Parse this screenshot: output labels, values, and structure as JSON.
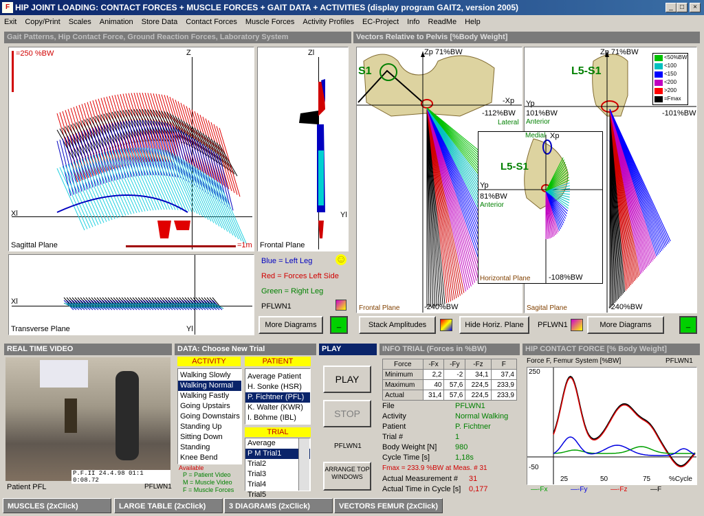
{
  "window": {
    "title": "HIP JOINT LOADING:  CONTACT FORCES + MUSCLE FORCES + GAIT DATA + ACTIVITIES (display program GAIT2, version 2005)"
  },
  "menu": [
    "Exit",
    "Copy/Print",
    "Scales",
    "Animation",
    "Store Data",
    "Contact Forces",
    "Muscle Forces",
    "Activity Profiles",
    "EC-Project",
    "Info",
    "ReadMe",
    "Help"
  ],
  "gait": {
    "title": "Gait Patterns, Hip Contact Force, Ground Reaction Forces, Laboratory System",
    "scale_label": "=250 %BW",
    "z": "Z",
    "zl": "Zl",
    "xl": "Xl",
    "yl": "Yl",
    "sagittal": "Sagittal Plane",
    "meter": "=1m",
    "frontal": "Frontal Plane",
    "transverse": "Transverse Plane",
    "legend_blue": "Blue = Left Leg",
    "legend_red": "Red = Forces Left Side",
    "legend_green": "Green = Right Leg",
    "trial": "PFLWN1",
    "more": "More Diagrams",
    "smiley": "☺"
  },
  "vectors": {
    "title": "Vectors Relative to Pelvis  [%Body Weight]",
    "zp_left": "Zp 71%BW",
    "s1": "S1",
    "neg_xp": "-Xp",
    "neg112": "-112%BW",
    "lateral": "Lateral",
    "frontal": "Frontal Plane",
    "neg240a": "-240%BW",
    "zp_right": "Zp 71%BW",
    "l5s1": "L5-S1",
    "yp": "Yp",
    "bw101": "101%BW",
    "anterior": "Anterior",
    "neg101": "-101%BW",
    "sagital": "Sagital Plane",
    "neg240b": "-240%BW",
    "medial": "Medial",
    "xp": "Xp",
    "l5s1b": "L5-S1",
    "yp2": "Yp",
    "bw81": "81%BW",
    "anterior2": "Anterior",
    "horizontal": "Horizontal Plane",
    "neg108": "-108%BW",
    "legend": [
      "<50%BW",
      "<100",
      "<150",
      "<200",
      ">200",
      "=Fmax"
    ],
    "legend_colors": [
      "#00c000",
      "#00c0c0",
      "#0000ff",
      "#c000c0",
      "#ff0000",
      "#000000"
    ],
    "stack": "Stack Amplitudes",
    "hide": "Hide Horiz. Plane",
    "trial": "PFLWN1",
    "more": "More Diagrams"
  },
  "video": {
    "title": "REAL TIME VIDEO",
    "patient": "Patient PFL",
    "code": "PFLWN1",
    "stamp": "P.F.II  24.4.98   01:1 0:08.72"
  },
  "data": {
    "title": "DATA: Choose New Trial",
    "activity_label": "ACTIVITY",
    "patient_label": "PATIENT",
    "activities": [
      "Walking Slowly",
      "Walking Normal",
      "Walking Fastly",
      "Going Upstairs",
      "Going Downstairs",
      "Standing Up",
      "Sitting Down",
      "Standing",
      "Knee Bend"
    ],
    "patients": [
      "Average Patient",
      "H. Sonke   (HSR)",
      "P. Fichtner (PFL)",
      "K. Walter   (KWR)",
      "I. Böhme    (IBL)"
    ],
    "trial_label": "TRIAL",
    "trials": [
      "Average",
      "P M  Trial1",
      "Trial2",
      "Trial3",
      "Trial4",
      "Trial5"
    ],
    "available": "Available",
    "notes": [
      "P = Patient Video",
      "M = Muscle Video",
      "F = Muscle Forces"
    ]
  },
  "play": {
    "title": "PLAY",
    "play": "PLAY",
    "stop": "STOP",
    "trial": "PFLWN1",
    "arrange": "ARRANGE TOP WINDOWS"
  },
  "info": {
    "title": "INFO TRIAL   (Forces in %BW)",
    "headers": [
      "Force",
      "-Fx",
      "-Fy",
      "-Fz",
      "F"
    ],
    "rows": [
      [
        "Minimum",
        "2,2",
        "-2",
        "34,1",
        "37,4"
      ],
      [
        "Maximum",
        "40",
        "57,6",
        "224,5",
        "233,9"
      ],
      [
        "Actual",
        "31,4",
        "57,6",
        "224,5",
        "233,9"
      ]
    ],
    "file_l": "File",
    "file": "PFLWN1",
    "act_l": "Activity",
    "act": "Normal Walking",
    "pat_l": "Patient",
    "pat": "P. Fichtner",
    "trial_l": "Trial #",
    "trial": "1",
    "bw_l": "Body Weight [N]",
    "bw": "980",
    "cyc_l": "Cycle Time [s]",
    "cyc": "1,18s",
    "fmax": "Fmax = 233.9 %BW at Meas. # 31",
    "am_l": "Actual Measurement    #",
    "am": "31",
    "at_l": "Actual Time in Cycle [s]",
    "at": "0,177"
  },
  "hcf": {
    "title": "HIP CONTACT FORCE  [% Body Weight]",
    "sub": "Force F, Femur System  [%BW]",
    "trial": "PFLWN1",
    "y250": "250",
    "yneg50": "-50",
    "x25": "25",
    "x50": "50",
    "x75": "75",
    "xcycle": "%Cycle",
    "leg": [
      "Fx",
      "Fy",
      "Fz",
      "F"
    ]
  },
  "tabs": [
    "MUSCLES   (2xClick)",
    "LARGE TABLE  (2xClick)",
    "3 DIAGRAMS   (2xClick)",
    "VECTORS FEMUR   (2xClick)"
  ]
}
